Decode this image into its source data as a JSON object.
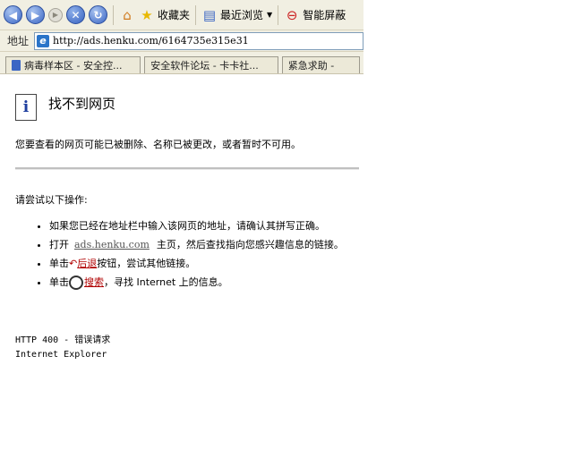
{
  "toolbar": {
    "favorites_label": "收藏夹",
    "recent_label": "最近浏览",
    "smart_label": "智能屏蔽"
  },
  "address": {
    "label": "地址",
    "url": "http://ads.henku.com/6164735e315e31"
  },
  "tabs": [
    {
      "label": "病毒样本区 - 安全控..."
    },
    {
      "label": "安全软件论坛 - 卡卡社..."
    },
    {
      "label": "紧急求助 -"
    }
  ],
  "page": {
    "title": "找不到网页",
    "description": "您要查看的网页可能已被删除、名称已被更改，或者暂时不可用。",
    "try_heading": "请尝试以下操作:",
    "tip1": "如果您已经在地址栏中输入该网页的地址，请确认其拼写正确。",
    "tip2_prefix": "打开",
    "tip2_link": "ads.henku.com",
    "tip2_suffix": "主页，然后查找指向您感兴趣信息的链接。",
    "tip3_prefix": "单击",
    "tip3_link": "后退",
    "tip3_suffix": "按钮，尝试其他链接。",
    "tip4_prefix": "单击",
    "tip4_link": "搜索",
    "tip4_suffix": "，寻找 Internet 上的信息。",
    "footer_line1": "HTTP 400 - 错误请求",
    "footer_line2": "Internet Explorer"
  }
}
